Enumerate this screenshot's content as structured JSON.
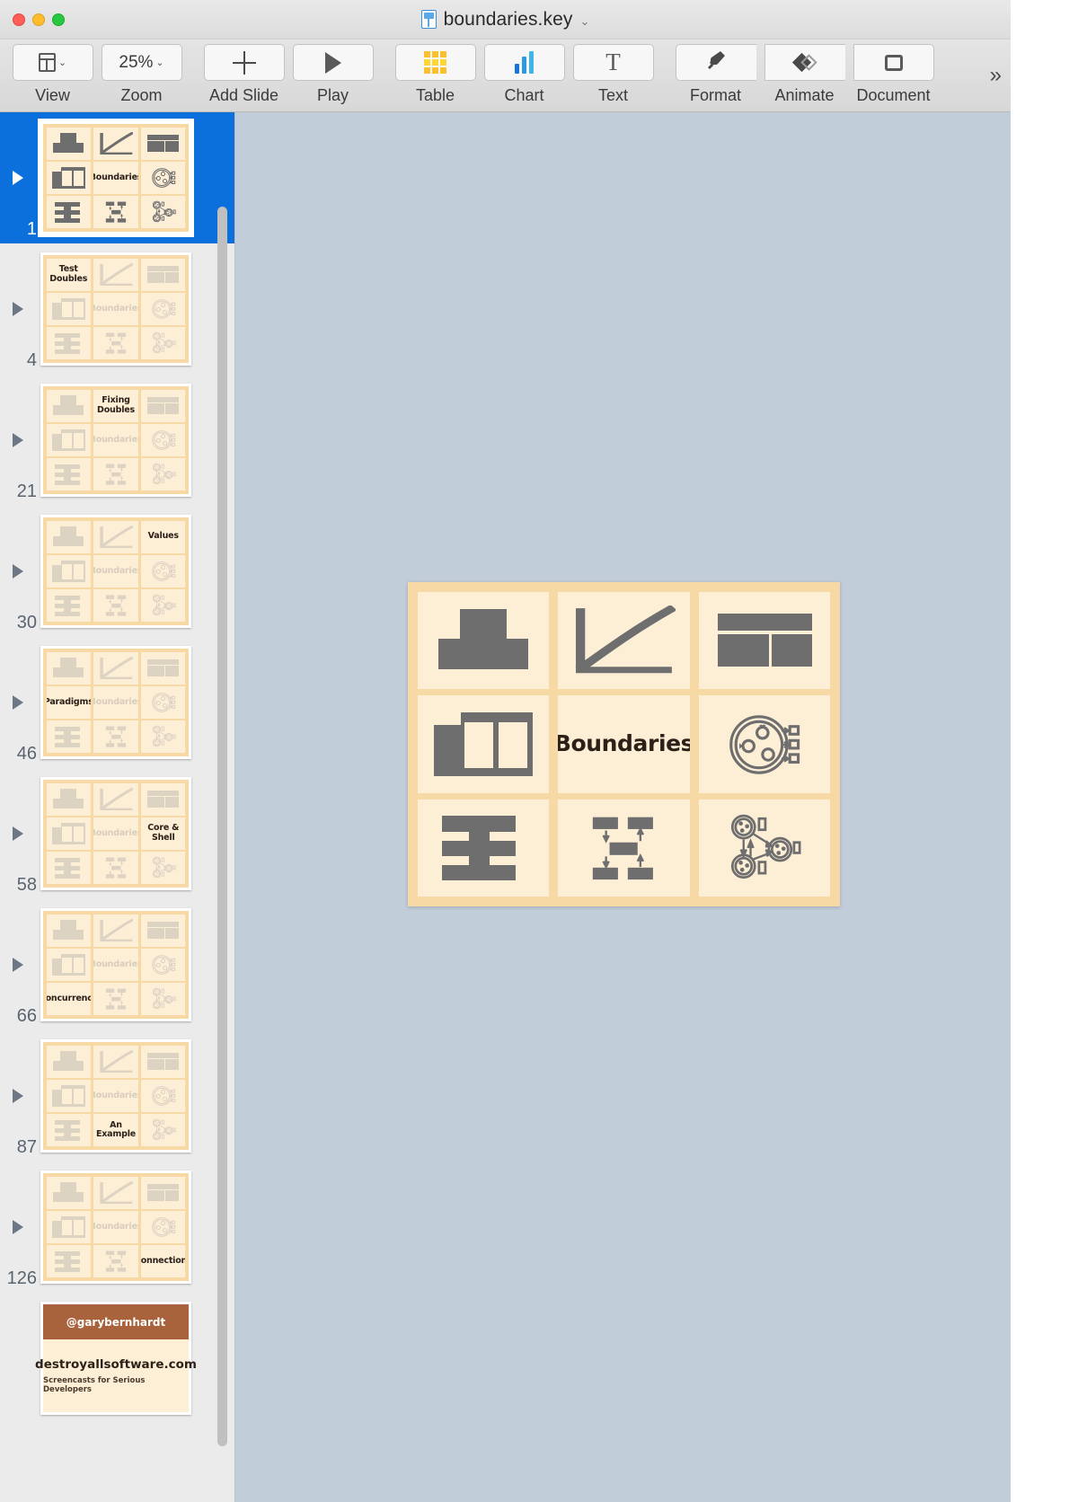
{
  "window": {
    "title": "boundaries.key",
    "title_chevron": "⌄",
    "doc_icon": "keynote-document-icon",
    "traffic_lights": [
      "close-button",
      "minimize-button",
      "maximize-button"
    ]
  },
  "toolbar": {
    "overflow_label": "»",
    "items": [
      {
        "label": "View",
        "icon": "view-layout-icon",
        "chevron": "⌄",
        "value": ""
      },
      {
        "label": "Zoom",
        "icon": "zoom-level-icon",
        "chevron": "⌄",
        "value": "25%"
      },
      {
        "label": "Add Slide",
        "icon": "plus-icon",
        "chevron": "",
        "value": ""
      },
      {
        "label": "Play",
        "icon": "play-icon",
        "chevron": "",
        "value": ""
      },
      {
        "label": "Table",
        "icon": "table-icon",
        "chevron": "",
        "value": ""
      },
      {
        "label": "Chart",
        "icon": "chart-bar-icon",
        "chevron": "",
        "value": ""
      },
      {
        "label": "Text",
        "icon": "text-t-icon",
        "chevron": "",
        "value": ""
      },
      {
        "label": "Format",
        "icon": "paintbrush-icon",
        "chevron": "",
        "value": ""
      },
      {
        "label": "Animate",
        "icon": "animate-diamond-icon",
        "chevron": "",
        "value": ""
      },
      {
        "label": "Document",
        "icon": "document-icon",
        "chevron": "",
        "value": ""
      }
    ]
  },
  "colors": {
    "slide_bg": "#f6d9a4",
    "cell_bg": "#fdeed6",
    "icon_active": "#6e6e6e",
    "icon_faded": "#ddd3c3",
    "selection_blue": "#0b6fdc",
    "canvas_bg": "#c2cdda",
    "promo_header": "#a8623c"
  },
  "sidebar": {
    "slides": [
      {
        "number": "1",
        "selected": true,
        "active_cell": 4,
        "label": "Boundaries",
        "ghost_label": ""
      },
      {
        "number": "4",
        "selected": false,
        "active_cell": 0,
        "label": "Test Doubles",
        "ghost_label": "Boundaries"
      },
      {
        "number": "21",
        "selected": false,
        "active_cell": 1,
        "label": "Fixing Doubles",
        "ghost_label": "Boundaries"
      },
      {
        "number": "30",
        "selected": false,
        "active_cell": 2,
        "label": "Values",
        "ghost_label": "Boundaries"
      },
      {
        "number": "46",
        "selected": false,
        "active_cell": 3,
        "label": "Paradigms",
        "ghost_label": "Boundaries"
      },
      {
        "number": "58",
        "selected": false,
        "active_cell": 5,
        "label": "Core & Shell",
        "ghost_label": "Boundaries"
      },
      {
        "number": "66",
        "selected": false,
        "active_cell": 6,
        "label": "Concurrency",
        "ghost_label": "Boundaries"
      },
      {
        "number": "87",
        "selected": false,
        "active_cell": 7,
        "label": "An Example",
        "ghost_label": "Boundaries"
      },
      {
        "number": "126",
        "selected": false,
        "active_cell": 8,
        "label": "Connections",
        "ghost_label": "Boundaries"
      }
    ],
    "promo_slide": {
      "handle": "@garybernhardt",
      "site": "destroyallsoftware.com",
      "tagline": "Screencasts for Serious Developers"
    },
    "cell_icons": [
      "stacked-blocks-icon",
      "exponential-curve-icon",
      "header-two-panes-icon",
      "sidebar-panels-icon",
      "center-label-cell",
      "circle-dots-boxes-icon",
      "interleaved-bars-icon",
      "flow-boxes-arrows-icon",
      "network-circles-icon"
    ]
  },
  "canvas": {
    "slide_title": "Boundaries",
    "zoom": "25%",
    "grid_rows": 3,
    "grid_cols": 3
  }
}
